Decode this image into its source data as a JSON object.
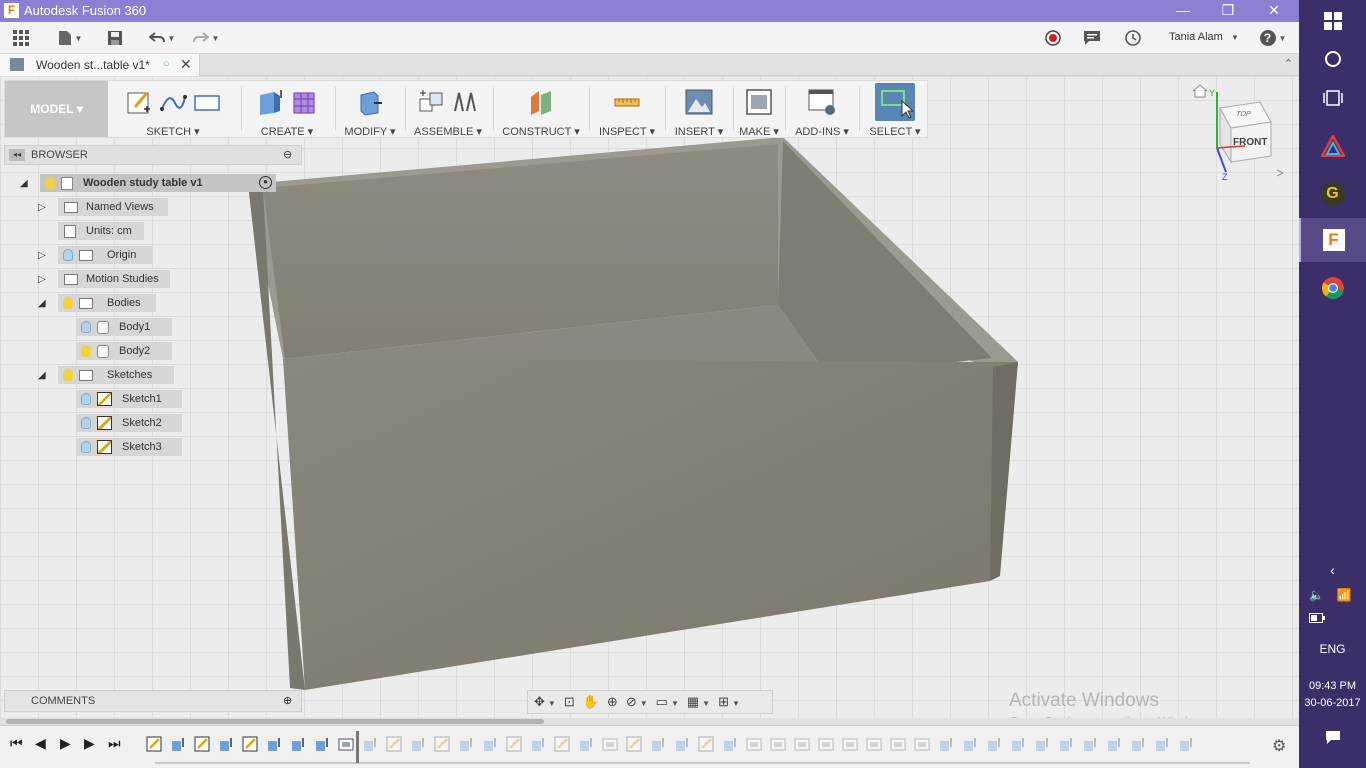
{
  "window": {
    "title": "Autodesk Fusion 360",
    "app_icon": "F",
    "minimize_icon": "—",
    "maximize_icon": "❐",
    "close_icon": "✕"
  },
  "qat": {
    "user_name": "Tania Alam",
    "help_icon": "?"
  },
  "tab": {
    "title": "Wooden st...table v1*",
    "close_icon": "✕",
    "collapse_icon": "⌃"
  },
  "ribbon": {
    "workspace": "MODEL ▾",
    "groups": [
      "SKETCH ▾",
      "CREATE ▾",
      "MODIFY ▾",
      "ASSEMBLE ▾",
      "CONSTRUCT ▾",
      "INSPECT ▾",
      "INSERT ▾",
      "MAKE ▾",
      "ADD-INS ▾",
      "SELECT ▾"
    ]
  },
  "browser": {
    "title": "BROWSER",
    "collapse_icon": "◂◂",
    "min_icon": "⊖",
    "root": "Wooden study table v1",
    "items": {
      "named_views": "Named Views",
      "units": "Units: cm",
      "origin": "Origin",
      "motion_studies": "Motion Studies",
      "bodies": "Bodies",
      "body1": "Body1",
      "body2": "Body2",
      "sketches": "Sketches",
      "sketch1": "Sketch1",
      "sketch2": "Sketch2",
      "sketch3": "Sketch3"
    }
  },
  "viewcube": {
    "front": "FRONT",
    "top": "TOP",
    "axis_y": "Y",
    "axis_z": "Z"
  },
  "comments": {
    "title": "COMMENTS",
    "add_icon": "⊕"
  },
  "watermark": {
    "line1": "Activate Windows",
    "line2": "Go to Settings to activate Windows."
  },
  "taskbar": {
    "language": "ENG",
    "time": "09:43 PM",
    "date": "30-06-2017"
  },
  "colors": {
    "titlebar": "#8b7fd3",
    "taskbar": "#3b2e69",
    "model_face": "#868474",
    "record": "#d01e1e"
  }
}
